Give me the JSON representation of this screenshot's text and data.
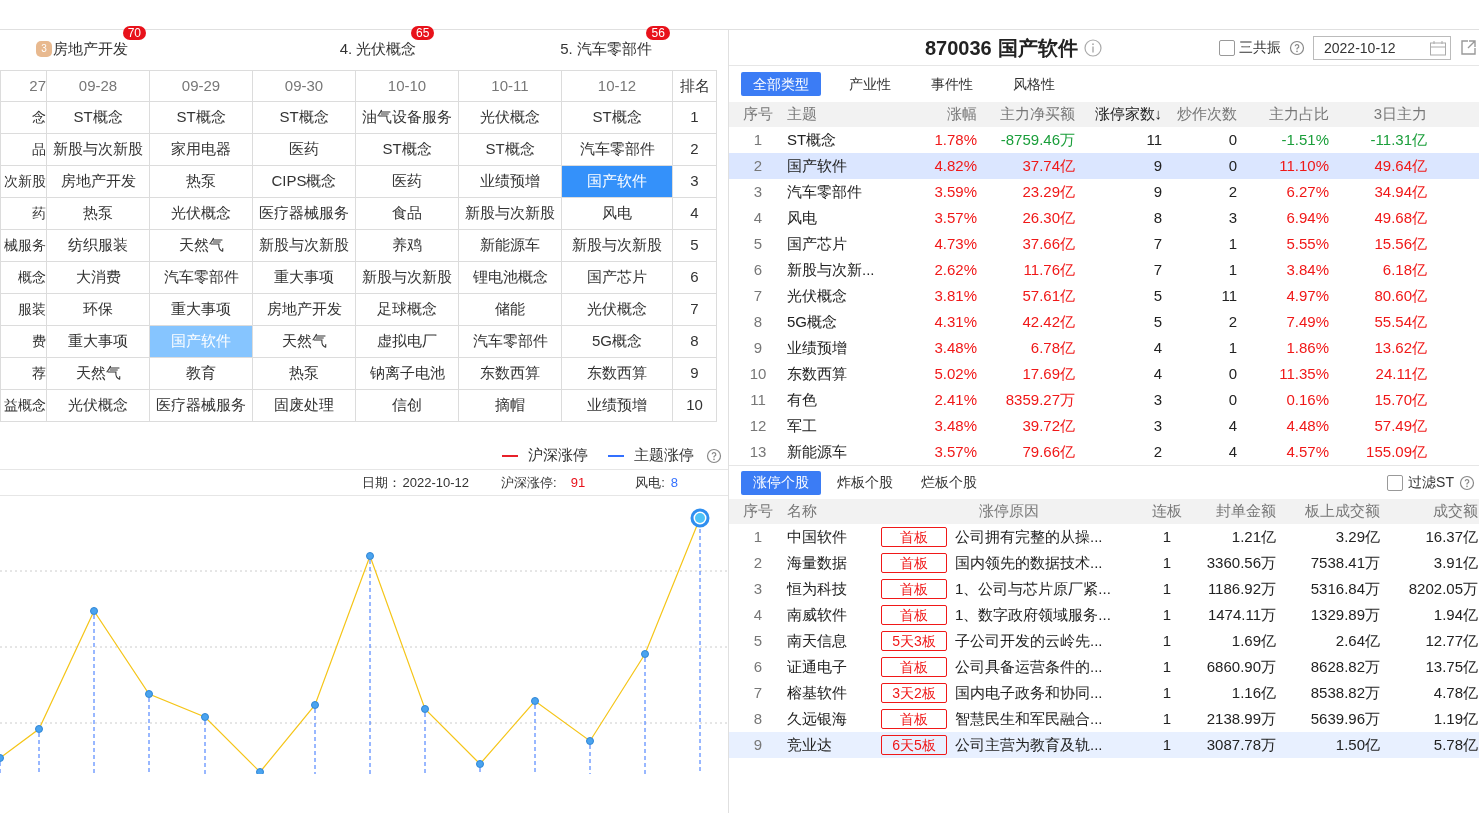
{
  "ranking_header": [
    {
      "kind": "medal",
      "rank": "3",
      "label": "房地产开发",
      "count": "70"
    },
    {
      "kind": "numbered",
      "label": "4. 光伏概念",
      "count": "65"
    },
    {
      "kind": "numbered",
      "label": "5. 汽车零部件",
      "count": "56"
    }
  ],
  "history_grid": {
    "columns": [
      "27",
      "09-28",
      "09-29",
      "09-30",
      "10-10",
      "10-11",
      "10-12"
    ],
    "rank_header": "排名",
    "rows": [
      {
        "rank": "1",
        "cells": [
          {
            "text": "念",
            "selected": false,
            "same_theme": false
          },
          {
            "text": "ST概念",
            "selected": false,
            "same_theme": false
          },
          {
            "text": "ST概念",
            "selected": false,
            "same_theme": false
          },
          {
            "text": "ST概念",
            "selected": false,
            "same_theme": false
          },
          {
            "text": "油气设备服务",
            "selected": false,
            "same_theme": false
          },
          {
            "text": "光伏概念",
            "selected": false,
            "same_theme": false
          },
          {
            "text": "ST概念",
            "selected": false,
            "same_theme": false
          }
        ]
      },
      {
        "rank": "2",
        "cells": [
          {
            "text": "品",
            "selected": false,
            "same_theme": false
          },
          {
            "text": "新股与次新股",
            "selected": false,
            "same_theme": false
          },
          {
            "text": "家用电器",
            "selected": false,
            "same_theme": false
          },
          {
            "text": "医药",
            "selected": false,
            "same_theme": false
          },
          {
            "text": "ST概念",
            "selected": false,
            "same_theme": false
          },
          {
            "text": "ST概念",
            "selected": false,
            "same_theme": false
          },
          {
            "text": "汽车零部件",
            "selected": false,
            "same_theme": false
          }
        ]
      },
      {
        "rank": "3",
        "cells": [
          {
            "text": "次新股",
            "selected": false,
            "same_theme": false
          },
          {
            "text": "房地产开发",
            "selected": false,
            "same_theme": false
          },
          {
            "text": "热泵",
            "selected": false,
            "same_theme": false
          },
          {
            "text": "CIPS概念",
            "selected": false,
            "same_theme": false
          },
          {
            "text": "医药",
            "selected": false,
            "same_theme": false
          },
          {
            "text": "业绩预增",
            "selected": false,
            "same_theme": false
          },
          {
            "text": "国产软件",
            "selected": true,
            "same_theme": true
          }
        ]
      },
      {
        "rank": "4",
        "cells": [
          {
            "text": "药",
            "selected": false,
            "same_theme": false
          },
          {
            "text": "热泵",
            "selected": false,
            "same_theme": false
          },
          {
            "text": "光伏概念",
            "selected": false,
            "same_theme": false
          },
          {
            "text": "医疗器械服务",
            "selected": false,
            "same_theme": false
          },
          {
            "text": "食品",
            "selected": false,
            "same_theme": false
          },
          {
            "text": "新股与次新股",
            "selected": false,
            "same_theme": false
          },
          {
            "text": "风电",
            "selected": false,
            "same_theme": false
          }
        ]
      },
      {
        "rank": "5",
        "cells": [
          {
            "text": "械服务",
            "selected": false,
            "same_theme": false
          },
          {
            "text": "纺织服装",
            "selected": false,
            "same_theme": false
          },
          {
            "text": "天然气",
            "selected": false,
            "same_theme": false
          },
          {
            "text": "新股与次新股",
            "selected": false,
            "same_theme": false
          },
          {
            "text": "养鸡",
            "selected": false,
            "same_theme": false
          },
          {
            "text": "新能源车",
            "selected": false,
            "same_theme": false
          },
          {
            "text": "新股与次新股",
            "selected": false,
            "same_theme": false
          }
        ]
      },
      {
        "rank": "6",
        "cells": [
          {
            "text": "概念",
            "selected": false,
            "same_theme": false
          },
          {
            "text": "大消费",
            "selected": false,
            "same_theme": false
          },
          {
            "text": "汽车零部件",
            "selected": false,
            "same_theme": false
          },
          {
            "text": "重大事项",
            "selected": false,
            "same_theme": false
          },
          {
            "text": "新股与次新股",
            "selected": false,
            "same_theme": false
          },
          {
            "text": "锂电池概念",
            "selected": false,
            "same_theme": false
          },
          {
            "text": "国产芯片",
            "selected": false,
            "same_theme": false
          }
        ]
      },
      {
        "rank": "7",
        "cells": [
          {
            "text": "服装",
            "selected": false,
            "same_theme": false
          },
          {
            "text": "环保",
            "selected": false,
            "same_theme": false
          },
          {
            "text": "重大事项",
            "selected": false,
            "same_theme": false
          },
          {
            "text": "房地产开发",
            "selected": false,
            "same_theme": false
          },
          {
            "text": "足球概念",
            "selected": false,
            "same_theme": false
          },
          {
            "text": "储能",
            "selected": false,
            "same_theme": false
          },
          {
            "text": "光伏概念",
            "selected": false,
            "same_theme": false
          }
        ]
      },
      {
        "rank": "8",
        "cells": [
          {
            "text": "费",
            "selected": false,
            "same_theme": false
          },
          {
            "text": "重大事项",
            "selected": false,
            "same_theme": false
          },
          {
            "text": "国产软件",
            "selected": false,
            "same_theme": true
          },
          {
            "text": "天然气",
            "selected": false,
            "same_theme": false
          },
          {
            "text": "虚拟电厂",
            "selected": false,
            "same_theme": false
          },
          {
            "text": "汽车零部件",
            "selected": false,
            "same_theme": false
          },
          {
            "text": "5G概念",
            "selected": false,
            "same_theme": false
          }
        ]
      },
      {
        "rank": "9",
        "cells": [
          {
            "text": "荐",
            "selected": false,
            "same_theme": false
          },
          {
            "text": "天然气",
            "selected": false,
            "same_theme": false
          },
          {
            "text": "教育",
            "selected": false,
            "same_theme": false
          },
          {
            "text": "热泵",
            "selected": false,
            "same_theme": false
          },
          {
            "text": "钠离子电池",
            "selected": false,
            "same_theme": false
          },
          {
            "text": "东数西算",
            "selected": false,
            "same_theme": false
          },
          {
            "text": "东数西算",
            "selected": false,
            "same_theme": false
          }
        ]
      },
      {
        "rank": "10",
        "cells": [
          {
            "text": "益概念",
            "selected": false,
            "same_theme": false
          },
          {
            "text": "光伏概念",
            "selected": false,
            "same_theme": false
          },
          {
            "text": "医疗器械服务",
            "selected": false,
            "same_theme": false
          },
          {
            "text": "固废处理",
            "selected": false,
            "same_theme": false
          },
          {
            "text": "信创",
            "selected": false,
            "same_theme": false
          },
          {
            "text": "摘帽",
            "selected": false,
            "same_theme": false
          },
          {
            "text": "业绩预增",
            "selected": false,
            "same_theme": false
          }
        ]
      }
    ]
  },
  "chart_legend": [
    {
      "label": "沪深涨停",
      "color": "#e8212a"
    },
    {
      "label": "主题涨停",
      "color": "#3370ff"
    }
  ],
  "chart_info": {
    "date_label": "日期：",
    "date": "2022-10-12",
    "market_label": "沪深涨停:",
    "market_value": "91",
    "theme_label": "风电:",
    "theme_value": "8"
  },
  "theme_title": {
    "code": "870036",
    "name": "国产软件"
  },
  "resonance": {
    "label": "三共振",
    "checked": false
  },
  "date_field": {
    "value": "2022-10-12"
  },
  "type_tabs": [
    {
      "label": "全部类型",
      "selected": true
    },
    {
      "label": "产业性",
      "selected": false
    },
    {
      "label": "事件性",
      "selected": false
    },
    {
      "label": "风格性",
      "selected": false
    }
  ],
  "theme_table": {
    "columns": [
      "序号",
      "主题",
      "涨幅",
      "主力净买额",
      "涨停家数↓",
      "炒作次数",
      "主力占比",
      "3日主力"
    ],
    "rows": [
      {
        "no": "1",
        "name": "ST概念",
        "change": "1.78%",
        "net_buy": "-8759.46万",
        "limit_count": "11",
        "hype_count": "0",
        "ratio": "-1.51%",
        "main_3d": "-11.31亿",
        "outflow": true,
        "selected": false
      },
      {
        "no": "2",
        "name": "国产软件",
        "change": "4.82%",
        "net_buy": "37.74亿",
        "limit_count": "9",
        "hype_count": "0",
        "ratio": "11.10%",
        "main_3d": "49.64亿",
        "outflow": false,
        "selected": true
      },
      {
        "no": "3",
        "name": "汽车零部件",
        "change": "3.59%",
        "net_buy": "23.29亿",
        "limit_count": "9",
        "hype_count": "2",
        "ratio": "6.27%",
        "main_3d": "34.94亿",
        "outflow": false,
        "selected": false
      },
      {
        "no": "4",
        "name": "风电",
        "change": "3.57%",
        "net_buy": "26.30亿",
        "limit_count": "8",
        "hype_count": "3",
        "ratio": "6.94%",
        "main_3d": "49.68亿",
        "outflow": false,
        "selected": false
      },
      {
        "no": "5",
        "name": "国产芯片",
        "change": "4.73%",
        "net_buy": "37.66亿",
        "limit_count": "7",
        "hype_count": "1",
        "ratio": "5.55%",
        "main_3d": "15.56亿",
        "outflow": false,
        "selected": false
      },
      {
        "no": "6",
        "name": "新股与次新...",
        "change": "2.62%",
        "net_buy": "11.76亿",
        "limit_count": "7",
        "hype_count": "1",
        "ratio": "3.84%",
        "main_3d": "6.18亿",
        "outflow": false,
        "selected": false
      },
      {
        "no": "7",
        "name": "光伏概念",
        "change": "3.81%",
        "net_buy": "57.61亿",
        "limit_count": "5",
        "hype_count": "11",
        "ratio": "4.97%",
        "main_3d": "80.60亿",
        "outflow": false,
        "selected": false
      },
      {
        "no": "8",
        "name": "5G概念",
        "change": "4.31%",
        "net_buy": "42.42亿",
        "limit_count": "5",
        "hype_count": "2",
        "ratio": "7.49%",
        "main_3d": "55.54亿",
        "outflow": false,
        "selected": false
      },
      {
        "no": "9",
        "name": "业绩预增",
        "change": "3.48%",
        "net_buy": "6.78亿",
        "limit_count": "4",
        "hype_count": "1",
        "ratio": "1.86%",
        "main_3d": "13.62亿",
        "outflow": false,
        "selected": false
      },
      {
        "no": "10",
        "name": "东数西算",
        "change": "5.02%",
        "net_buy": "17.69亿",
        "limit_count": "4",
        "hype_count": "0",
        "ratio": "11.35%",
        "main_3d": "24.11亿",
        "outflow": false,
        "selected": false
      },
      {
        "no": "11",
        "name": "有色",
        "change": "2.41%",
        "net_buy": "8359.27万",
        "limit_count": "3",
        "hype_count": "0",
        "ratio": "0.16%",
        "main_3d": "15.70亿",
        "outflow": false,
        "selected": false
      },
      {
        "no": "12",
        "name": "军工",
        "change": "3.48%",
        "net_buy": "39.72亿",
        "limit_count": "3",
        "hype_count": "4",
        "ratio": "4.48%",
        "main_3d": "57.49亿",
        "outflow": false,
        "selected": false
      },
      {
        "no": "13",
        "name": "新能源车",
        "change": "3.57%",
        "net_buy": "79.66亿",
        "limit_count": "2",
        "hype_count": "4",
        "ratio": "4.57%",
        "main_3d": "155.09亿",
        "outflow": false,
        "selected": false
      }
    ]
  },
  "stock_tabs": [
    {
      "label": "涨停个股",
      "selected": true
    },
    {
      "label": "炸板个股",
      "selected": false
    },
    {
      "label": "烂板个股",
      "selected": false
    }
  ],
  "filter_st": {
    "label": "过滤ST",
    "checked": false
  },
  "stock_table": {
    "columns": [
      "序号",
      "名称",
      "涨停原因",
      "连板",
      "封单金额",
      "板上成交额",
      "成交额"
    ],
    "rows": [
      {
        "no": "1",
        "name": "中国软件",
        "tag": "首板",
        "reason": "公司拥有完整的从操...",
        "streak": "1",
        "seal": "1.21亿",
        "board_volume": "3.29亿",
        "volume": "16.37亿",
        "selected": false
      },
      {
        "no": "2",
        "name": "海量数据",
        "tag": "首板",
        "reason": "国内领先的数据技术...",
        "streak": "1",
        "seal": "3360.56万",
        "board_volume": "7538.41万",
        "volume": "3.91亿",
        "selected": false
      },
      {
        "no": "3",
        "name": "恒为科技",
        "tag": "首板",
        "reason": "1、公司与芯片原厂紧...",
        "streak": "1",
        "seal": "1186.92万",
        "board_volume": "5316.84万",
        "volume": "8202.05万",
        "selected": false
      },
      {
        "no": "4",
        "name": "南威软件",
        "tag": "首板",
        "reason": "1、数字政府领域服务...",
        "streak": "1",
        "seal": "1474.11万",
        "board_volume": "1329.89万",
        "volume": "1.94亿",
        "selected": false
      },
      {
        "no": "5",
        "name": "南天信息",
        "tag": "5天3板",
        "reason": "子公司开发的云岭先...",
        "streak": "1",
        "seal": "1.69亿",
        "board_volume": "2.64亿",
        "volume": "12.77亿",
        "selected": false
      },
      {
        "no": "6",
        "name": "证通电子",
        "tag": "首板",
        "reason": "公司具备运营条件的...",
        "streak": "1",
        "seal": "6860.90万",
        "board_volume": "8628.82万",
        "volume": "13.75亿",
        "selected": false
      },
      {
        "no": "7",
        "name": "榕基软件",
        "tag": "3天2板",
        "reason": "国内电子政务和协同...",
        "streak": "1",
        "seal": "1.16亿",
        "board_volume": "8538.82万",
        "volume": "4.78亿",
        "selected": false
      },
      {
        "no": "8",
        "name": "久远银海",
        "tag": "首板",
        "reason": "智慧民生和军民融合...",
        "streak": "1",
        "seal": "2138.99万",
        "board_volume": "5639.96万",
        "volume": "1.19亿",
        "selected": false
      },
      {
        "no": "9",
        "name": "竞业达",
        "tag": "6天5板",
        "reason": "公司主营为教育及轨...",
        "streak": "1",
        "seal": "3087.78万",
        "board_volume": "1.50亿",
        "volume": "5.78亿",
        "selected": true
      }
    ]
  }
}
